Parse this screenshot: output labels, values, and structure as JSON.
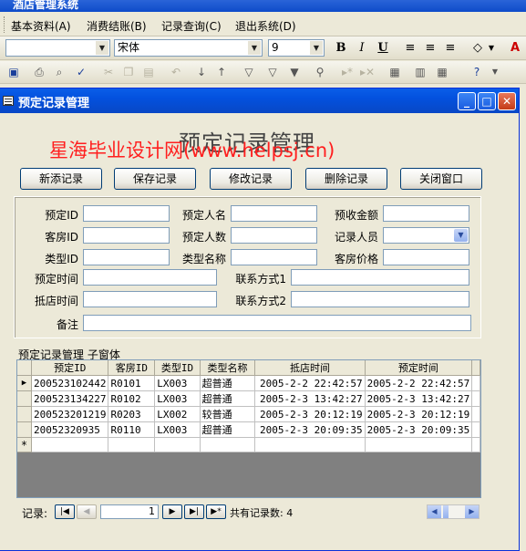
{
  "app": {
    "title": "酒店管理系统"
  },
  "menu": [
    "基本资料(A)",
    "消费结账(B)",
    "记录查询(C)",
    "退出系统(D)"
  ],
  "format_toolbar": {
    "font": "宋体",
    "size": "9",
    "bold": "B",
    "italic": "I",
    "underline": "U"
  },
  "window": {
    "title": "预定记录管理"
  },
  "form": {
    "heading": "预定记录管理",
    "watermark": "星海毕业设计网(www.helpsj.cn)",
    "buttons": [
      "新添记录",
      "保存记录",
      "修改记录",
      "删除记录",
      "关闭窗口"
    ],
    "labels": {
      "booking_id": "预定ID",
      "booker_name": "预定人名",
      "deposit": "预收金额",
      "room_id": "客房ID",
      "guest_count": "预定人数",
      "recorder": "记录人员",
      "type_id": "类型ID",
      "type_name": "类型名称",
      "room_price": "客房价格",
      "booking_time": "预定时间",
      "contact1": "联系方式1",
      "arrival_time": "抵店时间",
      "contact2": "联系方式2",
      "remark": "备注"
    }
  },
  "subform": {
    "title": "预定记录管理 子窗体",
    "columns": [
      "预定ID",
      "客房ID",
      "类型ID",
      "类型名称",
      "抵店时间",
      "预定时间"
    ],
    "rows": [
      [
        "200523102442",
        "R0101",
        "LX003",
        "超普通",
        "2005-2-2 22:42:57",
        "2005-2-2 22:42:57"
      ],
      [
        "200523134227",
        "R0102",
        "LX003",
        "超普通",
        "2005-2-3 13:42:27",
        "2005-2-3 13:42:27"
      ],
      [
        "200523201219",
        "R0203",
        "LX002",
        "较普通",
        "2005-2-3 20:12:19",
        "2005-2-3 20:12:19"
      ],
      [
        "20052320935",
        "R0110",
        "LX003",
        "超普通",
        "2005-2-3 20:09:35",
        "2005-2-3 20:09:35"
      ]
    ],
    "new_row_marker": "*",
    "current_row_marker": "▶"
  },
  "navigation": {
    "label": "记录:",
    "current": "1",
    "count_text": "共有记录数: 4"
  }
}
